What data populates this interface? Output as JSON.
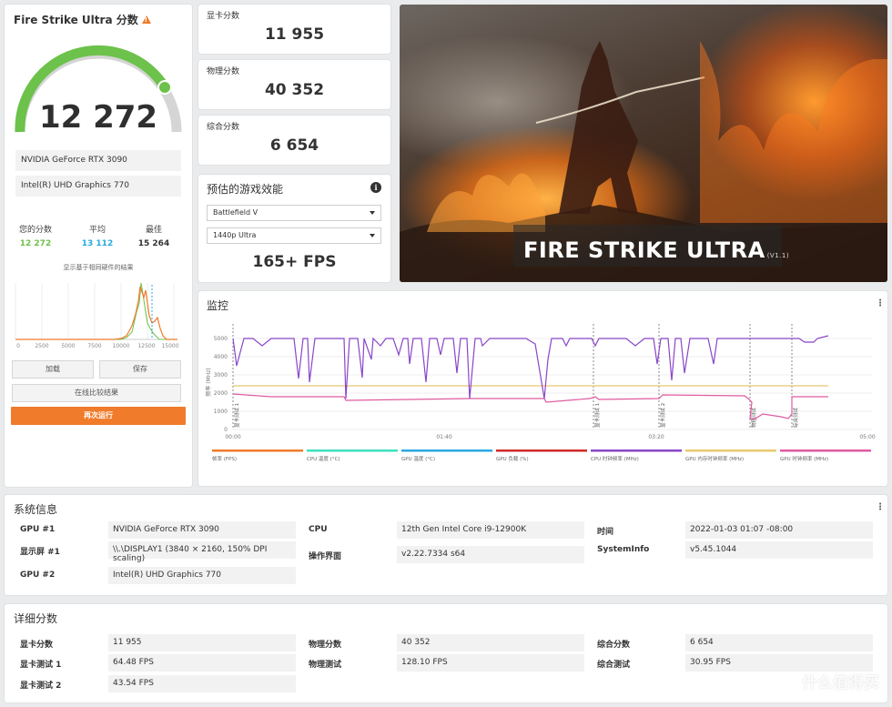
{
  "score": {
    "title": "Fire Strike Ultra 分数",
    "value": "12 272",
    "gpu1": "NVIDIA GeForce RTX 3090",
    "gpu2": "Intel(R) UHD Graphics 770",
    "yours_label": "您的分数",
    "yours": "12 272",
    "avg_label": "平均",
    "avg": "13 112",
    "best_label": "最佳",
    "best": "15 264",
    "hist_caption": "显示基于相同硬件的结果",
    "hist_ticks": [
      "0",
      "2500",
      "5000",
      "7500",
      "10000",
      "12500",
      "15000"
    ],
    "load_btn": "加载",
    "save_btn": "保存",
    "compare_btn": "在线比较结果",
    "run_btn": "再次运行"
  },
  "subscores": [
    {
      "label": "显卡分数",
      "value": "11 955"
    },
    {
      "label": "物理分数",
      "value": "40 352"
    },
    {
      "label": "综合分数",
      "value": "6 654"
    }
  ],
  "perf": {
    "title": "预估的游戏效能",
    "game": "Battlefield V",
    "preset": "1440p Ultra",
    "fps": "165+ FPS"
  },
  "hero": {
    "title": "FIRE STRIKE ULTRA",
    "version": "(V1.1)"
  },
  "monitor": {
    "title": "监控",
    "y_label": "频率 (MHz)",
    "y_ticks": [
      "5000",
      "4000",
      "3000",
      "2000",
      "1000",
      "0"
    ],
    "x_ticks": [
      "00:00",
      "01:40",
      "03:20",
      "05:00"
    ],
    "markers": [
      "显卡测试 1",
      "显卡测试 2",
      "物理测试",
      "综合测试"
    ],
    "legend": [
      {
        "name": "帧率 (FPS)",
        "color": "#f07b2a"
      },
      {
        "name": "CPU 温度 (°C)",
        "color": "#3fe0c0"
      },
      {
        "name": "GPU 温度 (°C)",
        "color": "#2aa8e0"
      },
      {
        "name": "GPU 负载 (%)",
        "color": "#d02a2a"
      },
      {
        "name": "CPU 时钟频率 (MHz)",
        "color": "#8a45c8"
      },
      {
        "name": "GPU 内存时钟频率 (MHz)",
        "color": "#e8c870"
      },
      {
        "name": "GPU 时钟频率 (MHz)",
        "color": "#e05aa0"
      }
    ]
  },
  "sysinfo": {
    "title": "系统信息",
    "rows": [
      {
        "label": "GPU #1",
        "value": "NVIDIA GeForce RTX 3090"
      },
      {
        "label": "显示屏 #1",
        "value": "\\\\.\\DISPLAY1 (3840 × 2160, 150% DPI scaling)"
      },
      {
        "label": "GPU #2",
        "value": "Intel(R) UHD Graphics 770"
      },
      {
        "label": "CPU",
        "value": "12th Gen Intel Core i9-12900K"
      },
      {
        "label": "操作界面",
        "value": "v2.22.7334 s64"
      },
      {
        "label": "时间",
        "value": "2022-01-03 01:07 -08:00"
      },
      {
        "label": "SystemInfo",
        "value": "v5.45.1044"
      }
    ]
  },
  "details": {
    "title": "详细分数",
    "rows": [
      {
        "label": "显卡分数",
        "value": "11 955"
      },
      {
        "label": "显卡测试 1",
        "value": "64.48 FPS"
      },
      {
        "label": "显卡测试 2",
        "value": "43.54 FPS"
      },
      {
        "label": "物理分数",
        "value": "40 352"
      },
      {
        "label": "物理测试",
        "value": "128.10 FPS"
      },
      {
        "label": "综合分数",
        "value": "6 654"
      },
      {
        "label": "综合测试",
        "value": "30.95 FPS"
      }
    ]
  },
  "watermark": "什么值得买"
}
